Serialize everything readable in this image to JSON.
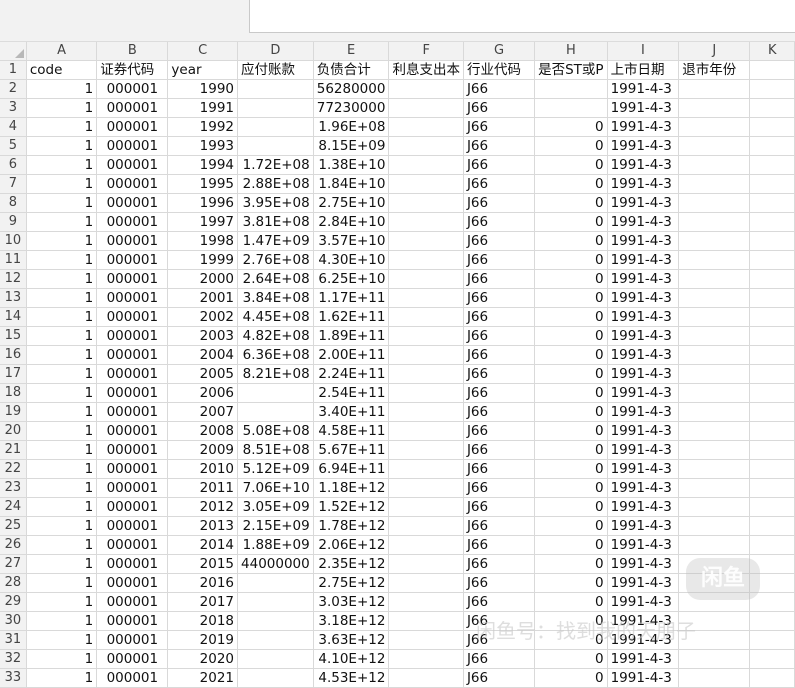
{
  "columns": [
    "A",
    "B",
    "C",
    "D",
    "E",
    "F",
    "G",
    "H",
    "I",
    "J",
    "K"
  ],
  "header_row": {
    "num": "1",
    "cells": [
      "code",
      "证券代码",
      "year",
      "应付账款",
      "负债合计",
      "利息支出本",
      "行业代码",
      "是否ST或P",
      "上市日期",
      "退市年份",
      ""
    ]
  },
  "rows": [
    {
      "num": "2",
      "cells": [
        "1",
        "000001",
        "1990",
        "",
        "56280000",
        "",
        "J66",
        "",
        "1991-4-3",
        "",
        ""
      ]
    },
    {
      "num": "3",
      "cells": [
        "1",
        "000001",
        "1991",
        "",
        "77230000",
        "",
        "J66",
        "",
        "1991-4-3",
        "",
        ""
      ]
    },
    {
      "num": "4",
      "cells": [
        "1",
        "000001",
        "1992",
        "",
        "1.96E+08",
        "",
        "J66",
        "0",
        "1991-4-3",
        "",
        ""
      ]
    },
    {
      "num": "5",
      "cells": [
        "1",
        "000001",
        "1993",
        "",
        "8.15E+09",
        "",
        "J66",
        "0",
        "1991-4-3",
        "",
        ""
      ]
    },
    {
      "num": "6",
      "cells": [
        "1",
        "000001",
        "1994",
        "1.72E+08",
        "1.38E+10",
        "",
        "J66",
        "0",
        "1991-4-3",
        "",
        ""
      ]
    },
    {
      "num": "7",
      "cells": [
        "1",
        "000001",
        "1995",
        "2.88E+08",
        "1.84E+10",
        "",
        "J66",
        "0",
        "1991-4-3",
        "",
        ""
      ]
    },
    {
      "num": "8",
      "cells": [
        "1",
        "000001",
        "1996",
        "3.95E+08",
        "2.75E+10",
        "",
        "J66",
        "0",
        "1991-4-3",
        "",
        ""
      ]
    },
    {
      "num": "9",
      "cells": [
        "1",
        "000001",
        "1997",
        "3.81E+08",
        "2.84E+10",
        "",
        "J66",
        "0",
        "1991-4-3",
        "",
        ""
      ]
    },
    {
      "num": "10",
      "cells": [
        "1",
        "000001",
        "1998",
        "1.47E+09",
        "3.57E+10",
        "",
        "J66",
        "0",
        "1991-4-3",
        "",
        ""
      ]
    },
    {
      "num": "11",
      "cells": [
        "1",
        "000001",
        "1999",
        "2.76E+08",
        "4.30E+10",
        "",
        "J66",
        "0",
        "1991-4-3",
        "",
        ""
      ]
    },
    {
      "num": "12",
      "cells": [
        "1",
        "000001",
        "2000",
        "2.64E+08",
        "6.25E+10",
        "",
        "J66",
        "0",
        "1991-4-3",
        "",
        ""
      ]
    },
    {
      "num": "13",
      "cells": [
        "1",
        "000001",
        "2001",
        "3.84E+08",
        "1.17E+11",
        "",
        "J66",
        "0",
        "1991-4-3",
        "",
        ""
      ]
    },
    {
      "num": "14",
      "cells": [
        "1",
        "000001",
        "2002",
        "4.45E+08",
        "1.62E+11",
        "",
        "J66",
        "0",
        "1991-4-3",
        "",
        ""
      ]
    },
    {
      "num": "15",
      "cells": [
        "1",
        "000001",
        "2003",
        "4.82E+08",
        "1.89E+11",
        "",
        "J66",
        "0",
        "1991-4-3",
        "",
        ""
      ]
    },
    {
      "num": "16",
      "cells": [
        "1",
        "000001",
        "2004",
        "6.36E+08",
        "2.00E+11",
        "",
        "J66",
        "0",
        "1991-4-3",
        "",
        ""
      ]
    },
    {
      "num": "17",
      "cells": [
        "1",
        "000001",
        "2005",
        "8.21E+08",
        "2.24E+11",
        "",
        "J66",
        "0",
        "1991-4-3",
        "",
        ""
      ]
    },
    {
      "num": "18",
      "cells": [
        "1",
        "000001",
        "2006",
        "",
        "2.54E+11",
        "",
        "J66",
        "0",
        "1991-4-3",
        "",
        ""
      ]
    },
    {
      "num": "19",
      "cells": [
        "1",
        "000001",
        "2007",
        "",
        "3.40E+11",
        "",
        "J66",
        "0",
        "1991-4-3",
        "",
        ""
      ]
    },
    {
      "num": "20",
      "cells": [
        "1",
        "000001",
        "2008",
        "5.08E+08",
        "4.58E+11",
        "",
        "J66",
        "0",
        "1991-4-3",
        "",
        ""
      ]
    },
    {
      "num": "21",
      "cells": [
        "1",
        "000001",
        "2009",
        "8.51E+08",
        "5.67E+11",
        "",
        "J66",
        "0",
        "1991-4-3",
        "",
        ""
      ]
    },
    {
      "num": "22",
      "cells": [
        "1",
        "000001",
        "2010",
        "5.12E+09",
        "6.94E+11",
        "",
        "J66",
        "0",
        "1991-4-3",
        "",
        ""
      ]
    },
    {
      "num": "23",
      "cells": [
        "1",
        "000001",
        "2011",
        "7.06E+10",
        "1.18E+12",
        "",
        "J66",
        "0",
        "1991-4-3",
        "",
        ""
      ]
    },
    {
      "num": "24",
      "cells": [
        "1",
        "000001",
        "2012",
        "3.05E+09",
        "1.52E+12",
        "",
        "J66",
        "0",
        "1991-4-3",
        "",
        ""
      ]
    },
    {
      "num": "25",
      "cells": [
        "1",
        "000001",
        "2013",
        "2.15E+09",
        "1.78E+12",
        "",
        "J66",
        "0",
        "1991-4-3",
        "",
        ""
      ]
    },
    {
      "num": "26",
      "cells": [
        "1",
        "000001",
        "2014",
        "1.88E+09",
        "2.06E+12",
        "",
        "J66",
        "0",
        "1991-4-3",
        "",
        ""
      ]
    },
    {
      "num": "27",
      "cells": [
        "1",
        "000001",
        "2015",
        "44000000",
        "2.35E+12",
        "",
        "J66",
        "0",
        "1991-4-3",
        "",
        ""
      ]
    },
    {
      "num": "28",
      "cells": [
        "1",
        "000001",
        "2016",
        "",
        "2.75E+12",
        "",
        "J66",
        "0",
        "1991-4-3",
        "",
        ""
      ]
    },
    {
      "num": "29",
      "cells": [
        "1",
        "000001",
        "2017",
        "",
        "3.03E+12",
        "",
        "J66",
        "0",
        "1991-4-3",
        "",
        ""
      ]
    },
    {
      "num": "30",
      "cells": [
        "1",
        "000001",
        "2018",
        "",
        "3.18E+12",
        "",
        "J66",
        "0",
        "1991-4-3",
        "",
        ""
      ]
    },
    {
      "num": "31",
      "cells": [
        "1",
        "000001",
        "2019",
        "",
        "3.63E+12",
        "",
        "J66",
        "0",
        "1991-4-3",
        "",
        ""
      ]
    },
    {
      "num": "32",
      "cells": [
        "1",
        "000001",
        "2020",
        "",
        "4.10E+12",
        "",
        "J66",
        "0",
        "1991-4-3",
        "",
        ""
      ]
    },
    {
      "num": "33",
      "cells": [
        "1",
        "000001",
        "2021",
        "",
        "4.53E+12",
        "",
        "J66",
        "0",
        "1991-4-3",
        "",
        ""
      ]
    }
  ],
  "overlay": {
    "tip_text": "闲鱼",
    "watermark_text": "闲鱼号：找到我的天朋子"
  }
}
